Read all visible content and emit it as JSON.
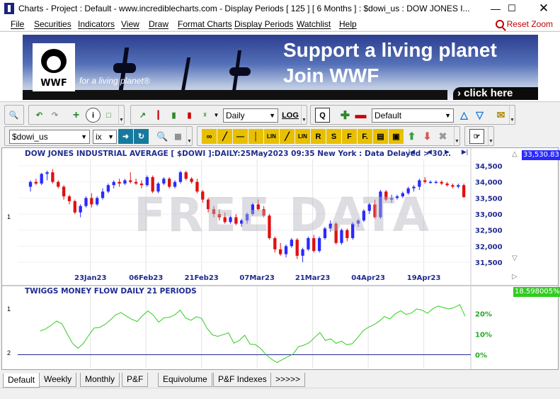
{
  "window": {
    "title": "Charts - Project : Default - www.incrediblecharts.com - Display Periods  [ 125 ]  [ 6 Months ] : $dowi_us : DOW JONES I...",
    "buttons": [
      "minimize",
      "maximize",
      "close"
    ]
  },
  "menu": {
    "items": [
      "File",
      "Securities",
      "Indicators",
      "View",
      "Draw",
      "Format Charts",
      "Display Periods",
      "Watchlist",
      "Help"
    ],
    "reset_zoom": "Reset Zoom"
  },
  "banner": {
    "logo": "WWF",
    "tagline": "for a living planet®",
    "headline1": "Support a living planet",
    "headline2": "Join WWF",
    "cta": "› click here"
  },
  "toolbar1": {
    "period": "Daily",
    "scale": "LOG",
    "project": "Default"
  },
  "toolbar2": {
    "security": "$dowi_us",
    "exchange": "ix",
    "draw_tools": [
      "LIN",
      "LIN",
      "R",
      "S",
      "F",
      "F."
    ]
  },
  "price_pane": {
    "title": "DOW JONES INDUSTRIAL AVERAGE [ $DOWI ]:DAILY:25May2023 09:35 New York : Data Delayed > 30...",
    "last_value": "33,530.83",
    "watermark": "FREE DATA",
    "pane_number": "1",
    "colors": {
      "up": "#2a2aff",
      "down": "#e01010",
      "axis": "#1f2b8f"
    }
  },
  "indicator_pane": {
    "title": "TWIGGS MONEY FLOW DAILY 21 PERIODS",
    "last_value": "18.598005%",
    "pane_number_top": "1",
    "pane_number_bottom": "2",
    "colors": {
      "line": "#33cc22",
      "axis": "#22aa22",
      "zero": "#1f2b8f"
    }
  },
  "chart_data": [
    {
      "type": "candlestick",
      "title": "DOW JONES INDUSTRIAL AVERAGE [ $DOWI ]:DAILY",
      "x_tick_labels": [
        "23Jan23",
        "06Feb23",
        "21Feb23",
        "07Mar23",
        "21Mar23",
        "04Apr23",
        "19Apr23"
      ],
      "y_tick_labels": [
        "31,500",
        "32,000",
        "32,500",
        "33,000",
        "33,500",
        "34,000",
        "34,500"
      ],
      "ylim": [
        31300,
        34700
      ],
      "last_price": 33530.83,
      "series": [
        {
          "name": "DOW JONES INDUSTRIAL AVERAGE",
          "values": [
            [
              33850,
              34050,
              33700,
              34000
            ],
            [
              34000,
              34100,
              33900,
              33950
            ],
            [
              33950,
              34280,
              33900,
              34250
            ],
            [
              34250,
              34350,
              34050,
              34300
            ],
            [
              34300,
              34400,
              33950,
              34000
            ],
            [
              34000,
              34050,
              33800,
              33850
            ],
            [
              33850,
              33900,
              33450,
              33550
            ],
            [
              33550,
              33600,
              33300,
              33400
            ],
            [
              33400,
              33450,
              33000,
              33050
            ],
            [
              33050,
              33300,
              32900,
              33250
            ],
            [
              33250,
              33550,
              33200,
              33500
            ],
            [
              33500,
              33650,
              33200,
              33300
            ],
            [
              33300,
              33550,
              33250,
              33500
            ],
            [
              33500,
              33800,
              33450,
              33700
            ],
            [
              33700,
              33950,
              33650,
              33900
            ],
            [
              33900,
              34050,
              33800,
              34000
            ],
            [
              34000,
              34100,
              33850,
              33950
            ],
            [
              33950,
              34100,
              33900,
              34050
            ],
            [
              34050,
              34300,
              33950,
              34000
            ],
            [
              34000,
              34100,
              33900,
              33950
            ],
            [
              33950,
              34050,
              33800,
              33900
            ],
            [
              33900,
              34200,
              33850,
              34150
            ],
            [
              34150,
              34200,
              33650,
              33700
            ],
            [
              33700,
              34000,
              33650,
              33950
            ],
            [
              33950,
              34150,
              33900,
              34100
            ],
            [
              34100,
              34150,
              33800,
              33850
            ],
            [
              33850,
              34050,
              33800,
              34000
            ],
            [
              34000,
              34350,
              33950,
              34300
            ],
            [
              34300,
              34350,
              34050,
              34100
            ],
            [
              34100,
              34150,
              33950,
              34000
            ],
            [
              34000,
              34100,
              33650,
              33700
            ],
            [
              33700,
              33750,
              33350,
              33450
            ],
            [
              33450,
              33500,
              33050,
              33150
            ],
            [
              33150,
              33250,
              32900,
              33000
            ],
            [
              33000,
              33150,
              32800,
              32900
            ],
            [
              32900,
              33050,
              32700,
              32750
            ],
            [
              32750,
              32950,
              32700,
              32900
            ],
            [
              32900,
              33000,
              32650,
              32700
            ],
            [
              32700,
              32850,
              32600,
              32800
            ],
            [
              32800,
              33050,
              32700,
              33000
            ],
            [
              33000,
              33350,
              32950,
              33300
            ],
            [
              33300,
              33450,
              33100,
              33150
            ],
            [
              33150,
              33250,
              32900,
              32950
            ],
            [
              32950,
              33000,
              32200,
              32250
            ],
            [
              32250,
              32300,
              31800,
              31900
            ],
            [
              31900,
              32100,
              31700,
              31750
            ],
            [
              31750,
              32050,
              31650,
              32000
            ],
            [
              32000,
              32250,
              31950,
              32200
            ],
            [
              32200,
              32250,
              31600,
              31700
            ],
            [
              31700,
              31950,
              31500,
              31900
            ],
            [
              31900,
              32300,
              31850,
              32250
            ],
            [
              32250,
              32350,
              31800,
              31850
            ],
            [
              31850,
              32300,
              31800,
              32250
            ],
            [
              32250,
              32600,
              32200,
              32550
            ],
            [
              32550,
              32800,
              32450,
              32700
            ],
            [
              32700,
              32750,
              32050,
              32100
            ],
            [
              32100,
              32550,
              32050,
              32500
            ],
            [
              32500,
              32550,
              32150,
              32250
            ],
            [
              32250,
              32750,
              32200,
              32700
            ],
            [
              32700,
              32850,
              32600,
              32800
            ],
            [
              32800,
              33150,
              32750,
              33100
            ],
            [
              33100,
              33350,
              33000,
              33300
            ],
            [
              33300,
              33450,
              32850,
              32900
            ],
            [
              32900,
              33750,
              32850,
              33700
            ],
            [
              33700,
              33750,
              33400,
              33450
            ],
            [
              33450,
              33600,
              33350,
              33500
            ],
            [
              33500,
              33600,
              33450,
              33550
            ],
            [
              33550,
              33700,
              33500,
              33650
            ],
            [
              33650,
              33850,
              33600,
              33800
            ],
            [
              33800,
              33900,
              33700,
              33850
            ],
            [
              33850,
              34100,
              33750,
              34050
            ],
            [
              34050,
              34150,
              33950,
              34000
            ],
            [
              34000,
              34050,
              33950,
              34000
            ],
            [
              34000,
              34050,
              33950,
              34000
            ],
            [
              34000,
              34050,
              33900,
              33950
            ],
            [
              33950,
              34000,
              33850,
              33900
            ],
            [
              33900,
              33950,
              33800,
              33850
            ],
            [
              33850,
              33950,
              33800,
              33900
            ],
            [
              33900,
              33950,
              33500,
              33530
            ]
          ]
        }
      ]
    },
    {
      "type": "line",
      "title": "TWIGGS MONEY FLOW DAILY 21 PERIODS",
      "y_tick_labels": [
        "0%",
        "10%",
        "20%"
      ],
      "ylim": [
        -5,
        28
      ],
      "last_value": 18.598005,
      "series": [
        {
          "name": "TWIGGS MONEY FLOW DAILY 21 PERIODS",
          "values": [
            11.5,
            12.5,
            14.2,
            16.3,
            15.0,
            10.1,
            5.4,
            3.1,
            5.5,
            9.4,
            12.9,
            13.2,
            14.6,
            16.8,
            19.3,
            20.4,
            18.7,
            17.2,
            16.1,
            18.9,
            21.2,
            19.2,
            15.8,
            17.9,
            18.1,
            19.3,
            21.6,
            17.8,
            16.7,
            18.4,
            17.6,
            12.8,
            9.6,
            8.9,
            9.7,
            10.6,
            5.6,
            6.9,
            9.4,
            5.1,
            4.9,
            2.9,
            -0.1,
            -2.2,
            -3.8,
            -2.4,
            -1.0,
            0.3,
            3.9,
            4.6,
            5.8,
            8.3,
            10.7,
            6.9,
            7.7,
            5.5,
            6.6,
            4.8,
            5.3,
            8.2,
            11.5,
            13.3,
            14.5,
            16.2,
            18.5,
            17.3,
            19.8,
            21.3,
            19.5,
            20.2,
            22.2,
            21.6,
            20.1,
            22.3,
            23.6,
            22.8,
            22.2,
            22.9,
            24.3,
            18.6
          ]
        }
      ]
    }
  ],
  "tabs": [
    "Default",
    "Weekly",
    "Monthly",
    "P&F",
    "Equivolume",
    "P&F Indexes",
    ">>>>>"
  ]
}
